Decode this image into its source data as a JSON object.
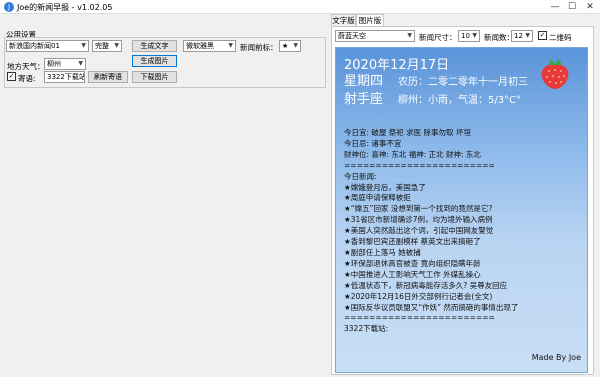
{
  "window": {
    "title": "Joe的新闻早报 - v1.02.05",
    "controls": {
      "minimize": "—",
      "maximize": "☐",
      "close": "✕"
    }
  },
  "left": {
    "section_title": "公用设置",
    "news_source": "新浪国内新闻01",
    "news_mode": "完整",
    "gen_text_button": "生成文字",
    "gen_image_button": "生成图片",
    "font": "微软雅黑",
    "news_prefix_label": "新闻前标：",
    "news_prefix_value": "★",
    "local_weather_label": "地方天气：",
    "city": "柳州",
    "quote_label": "寄语:",
    "quote_value": "3322下载站",
    "refresh_quote_button": "刷新寄语",
    "download_image_button": "下载图片"
  },
  "right": {
    "tabs": [
      "文字版",
      "图片版"
    ],
    "bg_style": "蔚蓝天空",
    "news_size_label": "新闻尺寸：",
    "news_size_value": "10",
    "news_count_label": "新闻数：",
    "news_count_value": "12",
    "qrcode_label": "二维码"
  },
  "preview": {
    "date": "2020年12月17日",
    "weekday": "星期四",
    "lunar": "农历：二零二零年十一月初三",
    "zodiac": "射手座",
    "weather": "柳州：小雨，气温：5/3°C°",
    "lines": [
      "今日宜: 破屋 祭祀 求医 除事勿取 坏垣",
      "今日忌: 诸事不宜",
      "财神位: 喜神: 东北 福神: 正北 财神: 东北",
      "========================",
      "今日新闻:",
      "★嫦娥登月后，美国急了",
      "★周庭申请保释被拒",
      "★“嫦五”回家 没想到第一个找到的竟然是它?",
      "★31省区市新增确诊7例，均为境外输入病例",
      "★美国人突然敲出这个词，引起中国网友警觉",
      "★香到黎巴宾还副模样 蔡英文出来搞砸了",
      "★副部任上落马 她被捕",
      "★环保部退休高官被查 竟向组织隐瞒年龄",
      "★中国推进人工影响天气工作 外媒乱操心",
      "★低温状态下，新冠病毒能存活多久? 吴尊友回应",
      "★2020年12月16日外交部例行记者会(全文)",
      "★国际反华议员联盟又“作妖” 然而搞砸的事情出现了",
      "========================",
      "3322下载站:"
    ],
    "footer": "Made By Joe"
  }
}
